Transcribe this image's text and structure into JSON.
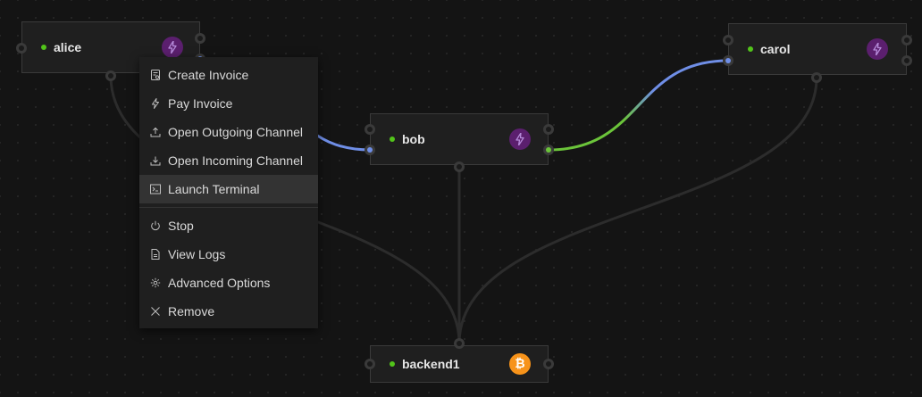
{
  "nodes": {
    "alice": {
      "name": "alice",
      "implementation": "lnd-icon",
      "status": "started"
    },
    "bob": {
      "name": "bob",
      "implementation": "lnd-icon",
      "status": "started"
    },
    "carol": {
      "name": "carol",
      "implementation": "lnd-icon",
      "status": "started"
    },
    "backend1": {
      "name": "backend1",
      "implementation": "bitcoin-icon",
      "status": "started"
    }
  },
  "context_menu": {
    "items": [
      {
        "label": "Create Invoice",
        "icon": "invoice-icon"
      },
      {
        "label": "Pay Invoice",
        "icon": "lightning-icon"
      },
      {
        "label": "Open Outgoing Channel",
        "icon": "upload-icon"
      },
      {
        "label": "Open Incoming Channel",
        "icon": "download-icon"
      },
      {
        "label": "Launch Terminal",
        "icon": "terminal-icon",
        "highlighted": true
      },
      {
        "label": "Stop",
        "icon": "power-icon"
      },
      {
        "label": "View Logs",
        "icon": "file-icon"
      },
      {
        "label": "Advanced Options",
        "icon": "settings-icon"
      },
      {
        "label": "Remove",
        "icon": "close-icon"
      }
    ]
  },
  "colors": {
    "canvas": "#141414",
    "status_started": "#52c41a",
    "channel_blue": "#6f8ee6",
    "channel_green": "#6bc43a",
    "lnd_badge": "#5b1f6e",
    "bitcoin_badge": "#f7931a",
    "backend_link": "#2c2c2c"
  }
}
